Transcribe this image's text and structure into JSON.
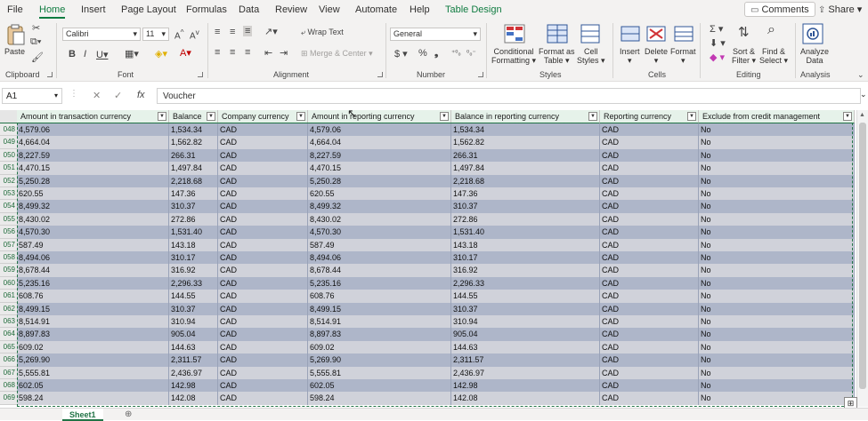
{
  "menu": [
    {
      "label": "File",
      "active": false
    },
    {
      "label": "Home",
      "active": true
    },
    {
      "label": "Insert",
      "active": false
    },
    {
      "label": "Page Layout",
      "active": false
    },
    {
      "label": "Formulas",
      "active": false
    },
    {
      "label": "Data",
      "active": false
    },
    {
      "label": "Review",
      "active": false
    },
    {
      "label": "View",
      "active": false
    },
    {
      "label": "Automate",
      "active": false
    },
    {
      "label": "Help",
      "active": false
    },
    {
      "label": "Table Design",
      "active": false
    }
  ],
  "topbar": {
    "comments": "Comments",
    "share": "Share"
  },
  "ribbon": {
    "clipboard": {
      "paste": "Paste",
      "label": "Clipboard"
    },
    "font": {
      "name": "Calibri",
      "size": "11",
      "label": "Font"
    },
    "alignment": {
      "wrap": "Wrap Text",
      "merge": "Merge & Center",
      "label": "Alignment"
    },
    "number": {
      "format": "General",
      "label": "Number"
    },
    "styles": {
      "conditional": "Conditional",
      "conditional2": "Formatting",
      "format_as": "Format as",
      "format_as2": "Table",
      "cell": "Cell",
      "cell2": "Styles",
      "label": "Styles"
    },
    "cells": {
      "insert": "Insert",
      "delete": "Delete",
      "format": "Format",
      "label": "Cells"
    },
    "editing": {
      "sort": "Sort &",
      "sort2": "Filter",
      "find": "Find &",
      "find2": "Select",
      "label": "Editing"
    },
    "analysis": {
      "analyze": "Analyze",
      "analyze2": "Data",
      "label": "Analysis"
    }
  },
  "formula_bar": {
    "name_box": "A1",
    "formula": "Voucher"
  },
  "columns": [
    "Amount in transaction currency",
    "Balance",
    "Company currency",
    "Amount in reporting currency",
    "Balance in reporting currency",
    "Reporting currency",
    "Exclude from credit management"
  ],
  "rows": [
    {
      "num": "048",
      "cells": [
        "4,579.06",
        "1,534.34",
        "CAD",
        "4,579.06",
        "1,534.34",
        "CAD",
        "No"
      ]
    },
    {
      "num": "049",
      "cells": [
        "4,664.04",
        "1,562.82",
        "CAD",
        "4,664.04",
        "1,562.82",
        "CAD",
        "No"
      ]
    },
    {
      "num": "050",
      "cells": [
        "8,227.59",
        "266.31",
        "CAD",
        "8,227.59",
        "266.31",
        "CAD",
        "No"
      ]
    },
    {
      "num": "051",
      "cells": [
        "4,470.15",
        "1,497.84",
        "CAD",
        "4,470.15",
        "1,497.84",
        "CAD",
        "No"
      ]
    },
    {
      "num": "052",
      "cells": [
        "5,250.28",
        "2,218.68",
        "CAD",
        "5,250.28",
        "2,218.68",
        "CAD",
        "No"
      ]
    },
    {
      "num": "053",
      "cells": [
        "620.55",
        "147.36",
        "CAD",
        "620.55",
        "147.36",
        "CAD",
        "No"
      ]
    },
    {
      "num": "054",
      "cells": [
        "8,499.32",
        "310.37",
        "CAD",
        "8,499.32",
        "310.37",
        "CAD",
        "No"
      ]
    },
    {
      "num": "055",
      "cells": [
        "8,430.02",
        "272.86",
        "CAD",
        "8,430.02",
        "272.86",
        "CAD",
        "No"
      ]
    },
    {
      "num": "056",
      "cells": [
        "4,570.30",
        "1,531.40",
        "CAD",
        "4,570.30",
        "1,531.40",
        "CAD",
        "No"
      ]
    },
    {
      "num": "057",
      "cells": [
        "587.49",
        "143.18",
        "CAD",
        "587.49",
        "143.18",
        "CAD",
        "No"
      ]
    },
    {
      "num": "058",
      "cells": [
        "8,494.06",
        "310.17",
        "CAD",
        "8,494.06",
        "310.17",
        "CAD",
        "No"
      ]
    },
    {
      "num": "059",
      "cells": [
        "8,678.44",
        "316.92",
        "CAD",
        "8,678.44",
        "316.92",
        "CAD",
        "No"
      ]
    },
    {
      "num": "060",
      "cells": [
        "5,235.16",
        "2,296.33",
        "CAD",
        "5,235.16",
        "2,296.33",
        "CAD",
        "No"
      ]
    },
    {
      "num": "061",
      "cells": [
        "608.76",
        "144.55",
        "CAD",
        "608.76",
        "144.55",
        "CAD",
        "No"
      ]
    },
    {
      "num": "062",
      "cells": [
        "8,499.15",
        "310.37",
        "CAD",
        "8,499.15",
        "310.37",
        "CAD",
        "No"
      ]
    },
    {
      "num": "063",
      "cells": [
        "8,514.91",
        "310.94",
        "CAD",
        "8,514.91",
        "310.94",
        "CAD",
        "No"
      ]
    },
    {
      "num": "064",
      "cells": [
        "8,897.83",
        "905.04",
        "CAD",
        "8,897.83",
        "905.04",
        "CAD",
        "No"
      ]
    },
    {
      "num": "065",
      "cells": [
        "609.02",
        "144.63",
        "CAD",
        "609.02",
        "144.63",
        "CAD",
        "No"
      ]
    },
    {
      "num": "066",
      "cells": [
        "5,269.90",
        "2,311.57",
        "CAD",
        "5,269.90",
        "2,311.57",
        "CAD",
        "No"
      ]
    },
    {
      "num": "067",
      "cells": [
        "5,555.81",
        "2,436.97",
        "CAD",
        "5,555.81",
        "2,436.97",
        "CAD",
        "No"
      ]
    },
    {
      "num": "068",
      "cells": [
        "602.05",
        "142.98",
        "CAD",
        "602.05",
        "142.98",
        "CAD",
        "No"
      ]
    },
    {
      "num": "069",
      "cells": [
        "598.24",
        "142.08",
        "CAD",
        "598.24",
        "142.08",
        "CAD",
        "No"
      ]
    }
  ],
  "sheet_tab": "Sheet1",
  "colors": {
    "accent": "#107c41",
    "row_dark": "#aeb6c9",
    "row_light": "#d0d2da",
    "header_bg": "#e6f2ea"
  }
}
